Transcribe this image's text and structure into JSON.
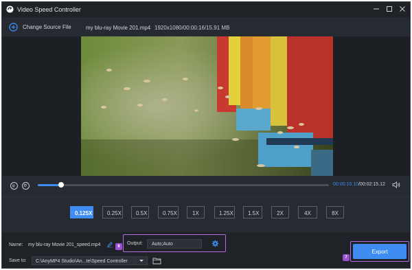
{
  "window": {
    "title": "Video Speed Controller"
  },
  "toolbar": {
    "change_source_label": "Change Source File",
    "file_name": "my blu-ray Movie 201.mp4",
    "file_meta": "1920x1080/00:00:16/15.91 MB"
  },
  "player": {
    "current_time": "00:00:10.10",
    "total_time": "/00:02:15.12",
    "progress": 0.08
  },
  "speeds": {
    "selected": "0.125X",
    "options": [
      "0.125X",
      "0.25X",
      "0.5X",
      "0.75X",
      "1X",
      "1.25X",
      "1.5X",
      "2X",
      "4X",
      "8X"
    ]
  },
  "output": {
    "name_label": "Name:",
    "name_value": "my blu-ray Movie 201_speed.mp4",
    "output_label": "Output:",
    "output_value": "Auto;Auto",
    "save_label": "Save to:",
    "save_path": "C:\\AnyMP4 Studio\\An...te\\Speed Controller",
    "export_label": "Export",
    "badge_output": "6",
    "badge_export": "7"
  },
  "colors": {
    "accent": "#3f8cf2",
    "highlight": "#b46be3",
    "background": "#262a31"
  },
  "icons": [
    "app-logo-icon",
    "minimize-icon",
    "maximize-icon",
    "close-icon",
    "plus-circle-icon",
    "pause-icon",
    "stop-icon",
    "volume-icon",
    "edit-icon",
    "gear-icon",
    "chevron-down-icon",
    "folder-icon"
  ]
}
